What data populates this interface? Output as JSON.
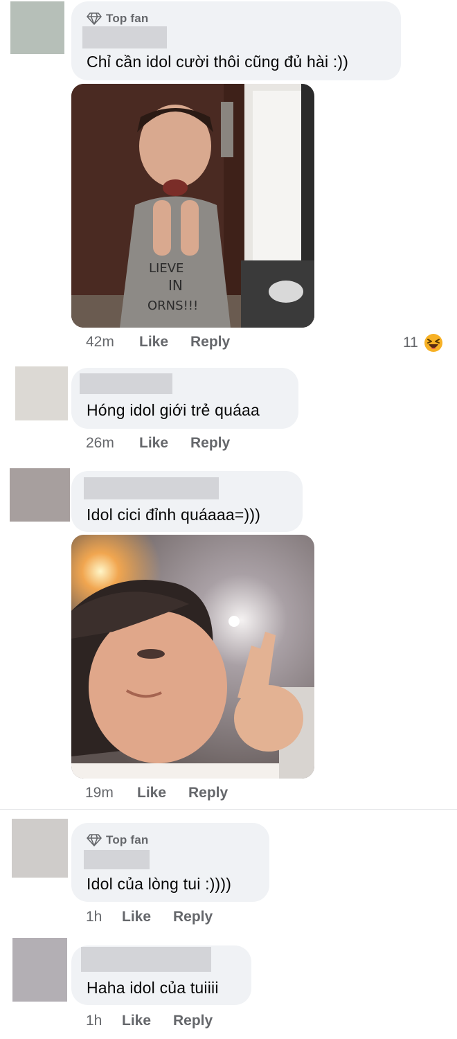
{
  "comments": [
    {
      "badge": "Top fan",
      "text": "Chỉ cần idol cười thôi cũng đủ hài :))",
      "time": "42m",
      "like": "Like",
      "reply": "Reply",
      "reaction_count": "11",
      "reaction_icon": "laughing-emoji-icon"
    },
    {
      "text": "Hóng idol giới trẻ quáaa",
      "time": "26m",
      "like": "Like",
      "reply": "Reply"
    },
    {
      "text": "Idol cici đỉnh quáaaa=)))",
      "time": "19m",
      "like": "Like",
      "reply": "Reply"
    },
    {
      "badge": "Top fan",
      "text": "Idol của lòng tui :))))",
      "time": "1h",
      "like": "Like",
      "reply": "Reply"
    },
    {
      "text": "Haha idol của tuiiii",
      "time": "1h",
      "like": "Like",
      "reply": "Reply"
    }
  ],
  "colors": {
    "bubble": "#f0f2f5",
    "secondary_text": "#65676b",
    "primary_text": "#050505"
  },
  "icons": {
    "badge": "diamond-icon"
  }
}
